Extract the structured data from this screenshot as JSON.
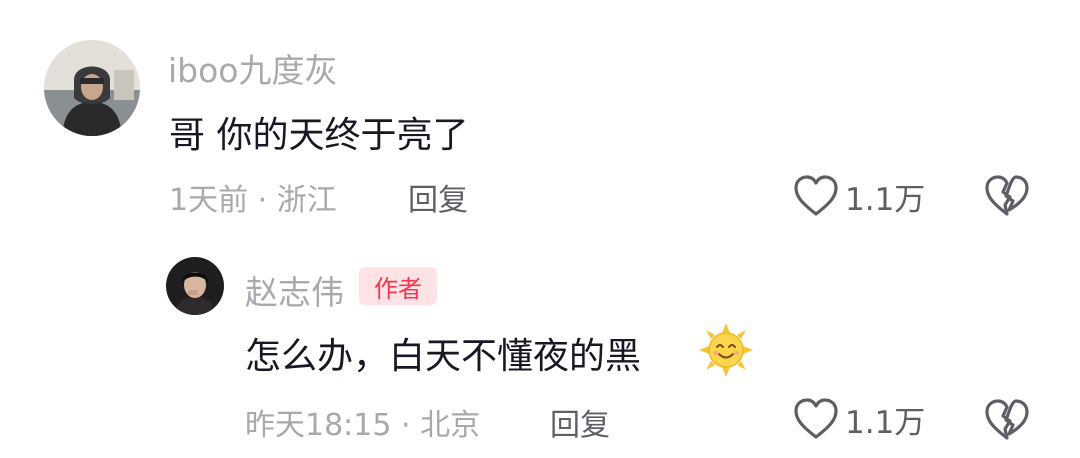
{
  "comments": [
    {
      "username": "iboo九度灰",
      "text": "哥 你的天终于亮了",
      "meta": "1天前 · 浙江",
      "reply_label": "回复",
      "like_count": "1.1万",
      "avatar_icon": "user-avatar-hooded"
    },
    {
      "username": "赵志伟",
      "badge": "作者",
      "text": "怎么办，白天不懂夜的黑",
      "emoji_icon": "smiling-sun-emoji",
      "meta": "昨天18:15 · 北京",
      "reply_label": "回复",
      "like_count": "1.1万",
      "avatar_icon": "user-avatar-portrait"
    }
  ],
  "colors": {
    "primary_text": "#161823",
    "secondary_text": "#a9a9ad",
    "action_text": "#5e5f66",
    "badge_bg": "#fde3e6",
    "badge_text": "#f2384f"
  }
}
